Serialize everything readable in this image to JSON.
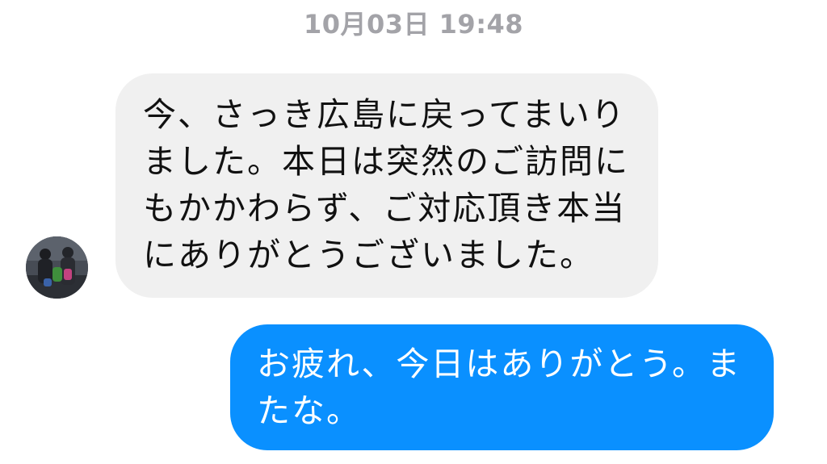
{
  "conversation": {
    "timestamp": "10月03日 19:48",
    "messages": [
      {
        "direction": "incoming",
        "text": "今、さっき広島に戻ってまいりました。本日は突然のご訪問にもかかわらず、ご対応頂き本当にありがとうございました。"
      },
      {
        "direction": "outgoing",
        "text": "お疲れ、今日はありがとう。またな。"
      }
    ]
  },
  "colors": {
    "incoming_bubble": "#f0f0f0",
    "outgoing_bubble": "#0a90ff",
    "timestamp_text": "#a3a3a8"
  }
}
